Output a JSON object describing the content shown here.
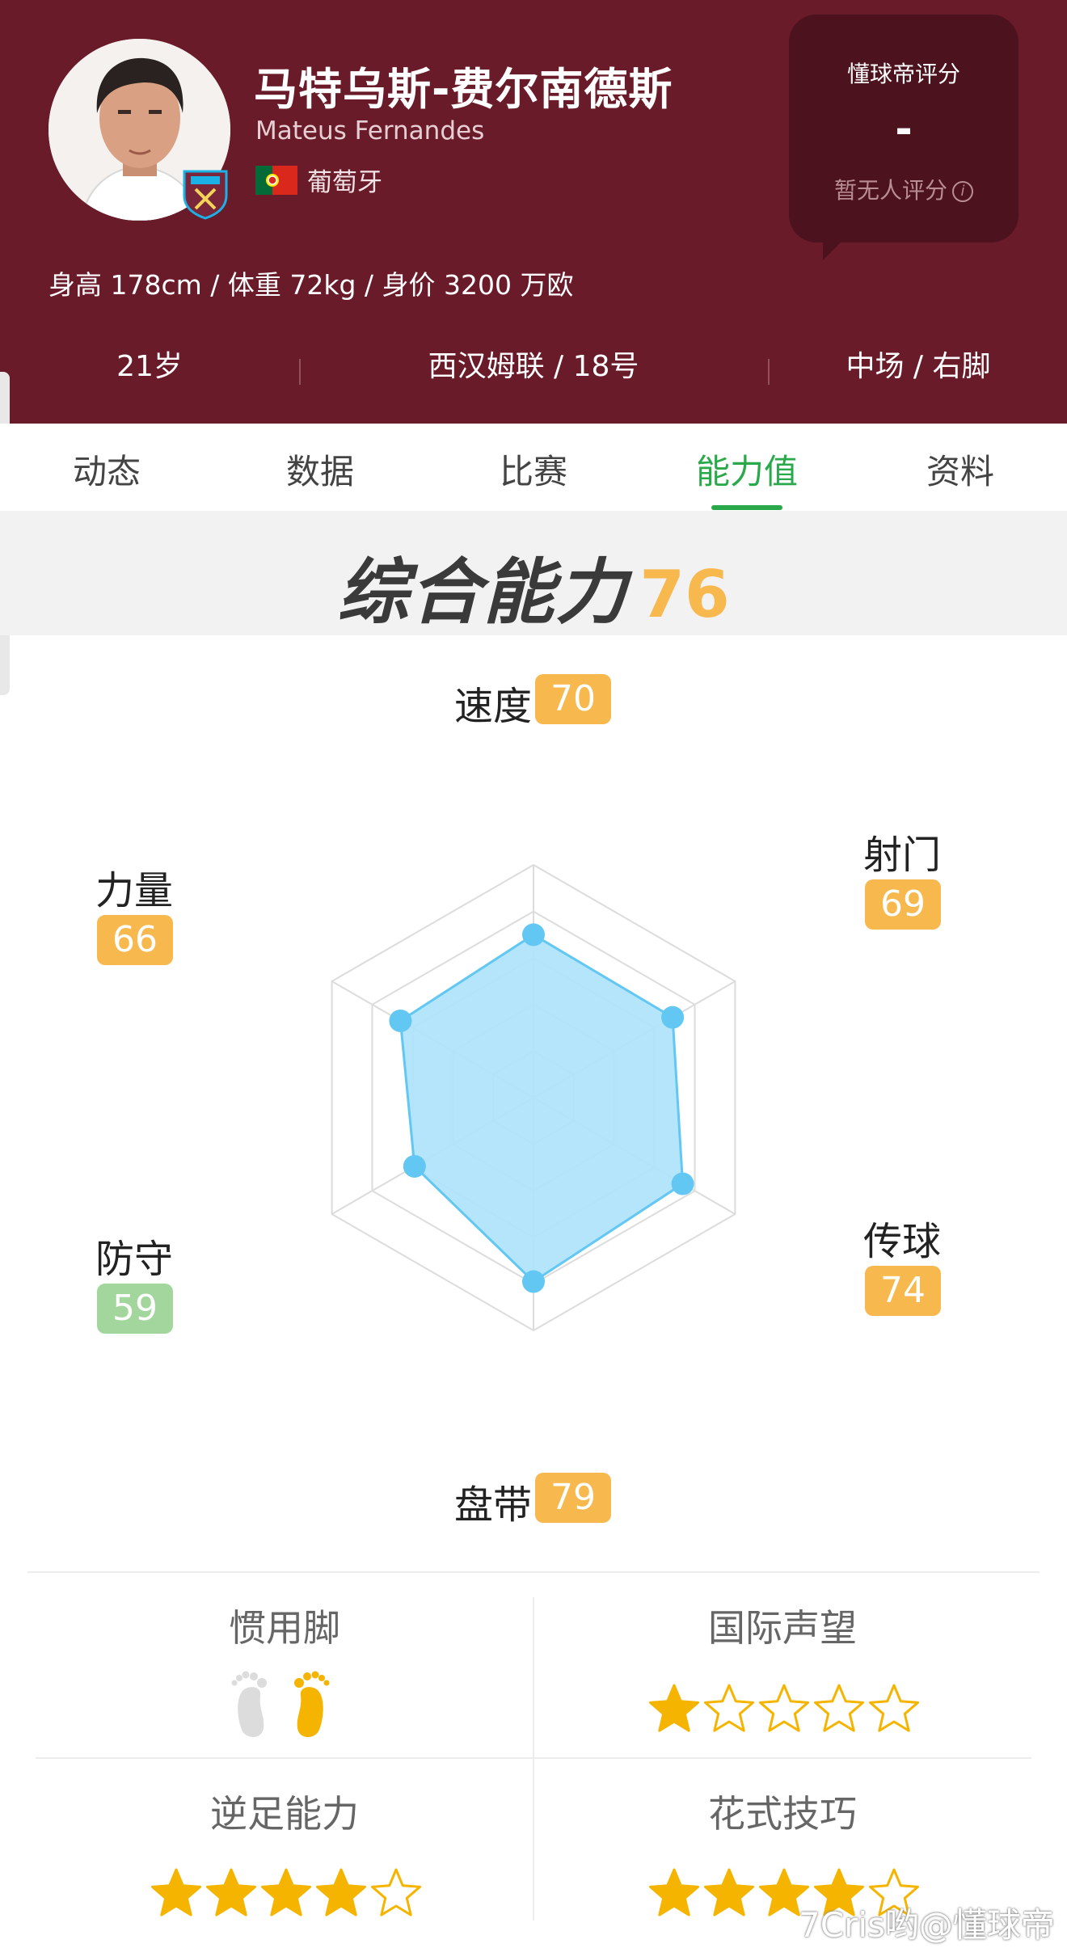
{
  "player": {
    "name_cn": "马特乌斯-费尔南德斯",
    "name_en": "Mateus Fernandes",
    "nation": "葡萄牙",
    "body_info": "身高 178cm / 体重 72kg / 身价 3200 万欧",
    "age": "21岁",
    "club_number": "西汉姆联 / 18号",
    "position_foot": "中场 / 右脚"
  },
  "rating": {
    "title": "懂球帝评分",
    "value": "-",
    "subtitle": "暂无人评分"
  },
  "tabs": [
    {
      "label": "动态"
    },
    {
      "label": "数据"
    },
    {
      "label": "比赛"
    },
    {
      "label": "能力值"
    },
    {
      "label": "资料"
    }
  ],
  "active_tab": "能力值",
  "overall": {
    "label": "综合能力",
    "value": "76"
  },
  "radar": {
    "max": 100,
    "attributes": [
      {
        "label": "速度",
        "value": 70,
        "color": "#f7b84e"
      },
      {
        "label": "射门",
        "value": 69,
        "color": "#f7b84e"
      },
      {
        "label": "传球",
        "value": 74,
        "color": "#f7b84e"
      },
      {
        "label": "盘带",
        "value": 79,
        "color": "#f7b84e"
      },
      {
        "label": "防守",
        "value": 59,
        "color": "#a3d69c"
      },
      {
        "label": "力量",
        "value": 66,
        "color": "#f7b84e"
      }
    ],
    "fill_color": "#aee3fb",
    "stroke_color": "#62c7f2",
    "grid_color": "#dcdcdc"
  },
  "traits": {
    "preferred_foot": {
      "label": "惯用脚",
      "left": false,
      "right": true
    },
    "international_reputation": {
      "label": "国际声望",
      "stars": 1,
      "max": 5
    },
    "weak_foot": {
      "label": "逆足能力",
      "stars": 4,
      "max": 5
    },
    "skill_moves": {
      "label": "花式技巧",
      "stars": 4,
      "max": 5
    }
  },
  "watermark": "7Cris哟@懂球帝",
  "colors": {
    "header_bg": "#6a1b29",
    "accent_green": "#29a94a",
    "star_gold": "#f5b400"
  }
}
